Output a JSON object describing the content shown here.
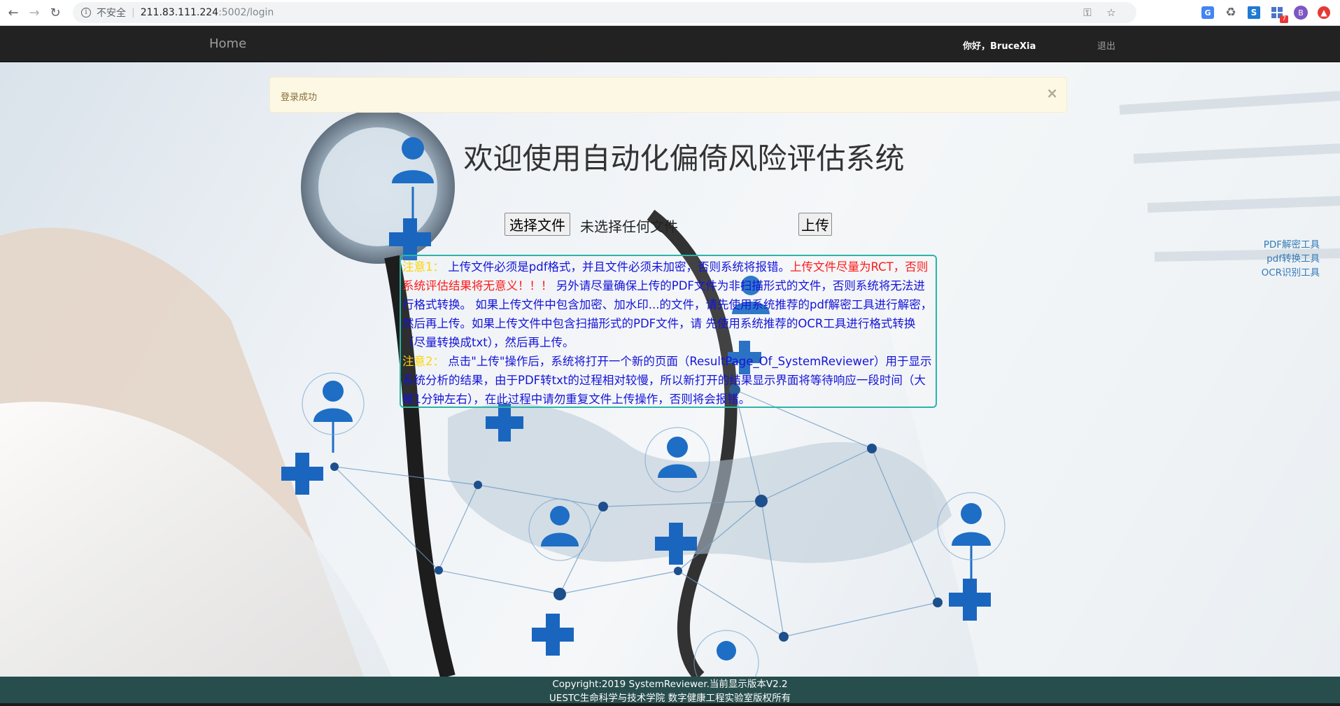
{
  "browser": {
    "security_label": "不安全",
    "url_host": "211.83.111.224",
    "url_path": ":5002/login",
    "avatar_letter": "B",
    "badge_count": "7"
  },
  "navbar": {
    "home_label": "Home",
    "greeting": "你好，BruceXia",
    "logout_label": "退出"
  },
  "alert": {
    "message": "登录成功",
    "close_symbol": "×"
  },
  "main": {
    "title": "欢迎使用自动化偏倚风险评估系统",
    "choose_file_label": "选择文件",
    "file_status": "未选择任何文件",
    "upload_label": "上传"
  },
  "notice": {
    "label1": "注意1：",
    "text1a": " 上传文件必须是pdf格式，并且文件必须未加密，否则系统将报错。",
    "text1_warn": "上传文件尽量为RCT，否则系统评估结果将无意义！！！",
    "text1b": " 另外请尽量确保上传的PDF文件为非扫描形式的文件，否则系统将无法进行格式转换。 如果上传文件中包含加密、加水印...的文件，请先使用系统推荐的pdf解密工具进行解密，然后再上传。如果上传文件中包含扫描形式的PDF文件，请 先使用系统推荐的OCR工具进行格式转换（尽量转换成txt），然后再上传。",
    "label2": "注意2：",
    "text2": " 点击\"上传\"操作后，系统将打开一个新的页面（ResultPage_Of_SystemReviewer）用于显示系统分析的结果，由于PDF转txt的过程相对较慢，所以新打开的结果显示界面将等待响应一段时间（大概1分钟左右），在此过程中请勿重复文件上传操作，否则将会报错。"
  },
  "side_links": [
    {
      "label": "PDF解密工具"
    },
    {
      "label": "pdf转换工具"
    },
    {
      "label": "OCR识别工具"
    }
  ],
  "footer": {
    "line1": "Copyright:2019 SystemReviewer.当前显示版本V2.2",
    "line2": "UESTC生命科学与技术学院 数字健康工程实验室版权所有"
  },
  "colors": {
    "navbar_bg": "#222222",
    "footer_bg": "#284d4d",
    "notice_border": "#2bb5a8",
    "notice_text": "#1414d8",
    "notice_label": "#ffd400",
    "notice_warn": "#ff1a1a",
    "link": "#337ab7",
    "alert_bg": "#fcf8e3"
  }
}
